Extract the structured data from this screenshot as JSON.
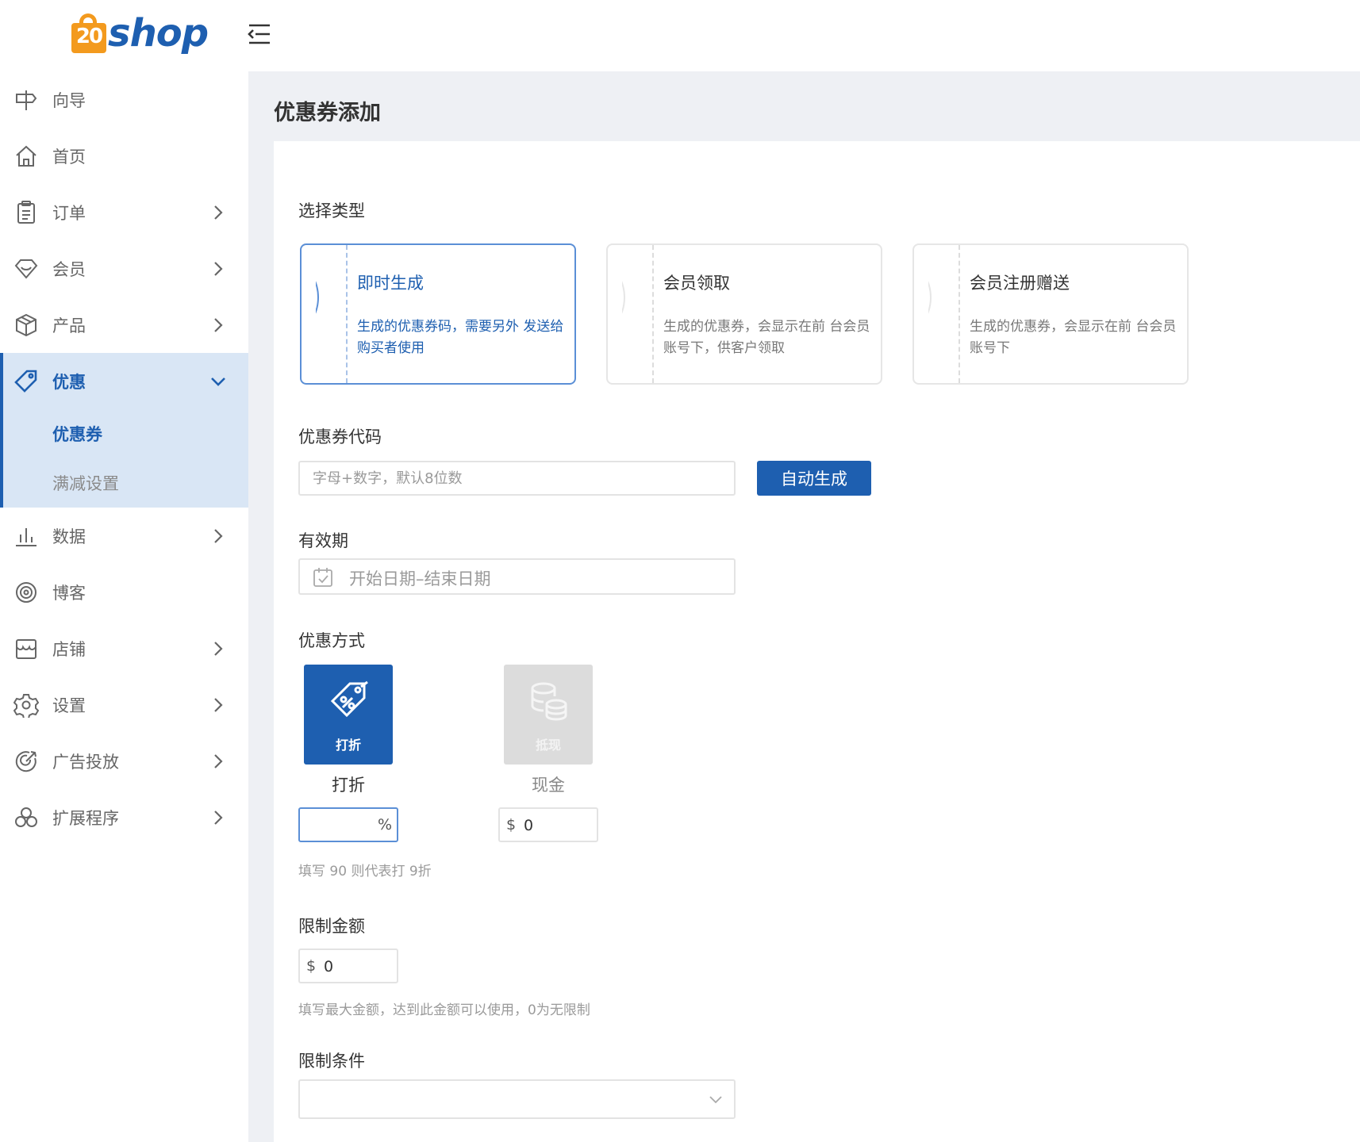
{
  "brand": {
    "logo_number": "20",
    "logo_text": "shop"
  },
  "sidebar": {
    "items": [
      {
        "label": "向导",
        "icon": "signpost-icon"
      },
      {
        "label": "首页",
        "icon": "home-icon"
      },
      {
        "label": "订单",
        "icon": "order-icon"
      },
      {
        "label": "会员",
        "icon": "member-icon"
      },
      {
        "label": "产品",
        "icon": "box-icon"
      },
      {
        "label": "优惠",
        "icon": "tag-icon"
      },
      {
        "label": "数据",
        "icon": "chart-icon"
      },
      {
        "label": "博客",
        "icon": "blog-icon"
      },
      {
        "label": "店铺",
        "icon": "store-icon"
      },
      {
        "label": "设置",
        "icon": "gear-icon"
      },
      {
        "label": "广告投放",
        "icon": "target-icon"
      },
      {
        "label": "扩展程序",
        "icon": "extension-icon"
      }
    ],
    "promo_sub": [
      {
        "label": "优惠券"
      },
      {
        "label": "满减设置"
      }
    ]
  },
  "page": {
    "title": "优惠券添加"
  },
  "form": {
    "type_label": "选择类型",
    "types": [
      {
        "title": "即时生成",
        "desc": "生成的优惠券码，需要另外 发送给购买者使用"
      },
      {
        "title": "会员领取",
        "desc": "生成的优惠券，会显示在前 台会员账号下，供客户领取"
      },
      {
        "title": "会员注册赠送",
        "desc": "生成的优惠券，会显示在前 台会员账号下"
      }
    ],
    "code_label": "优惠券代码",
    "code_placeholder": "字母+数字，默认8位数",
    "auto_generate": "自动生成",
    "validity_label": "有效期",
    "validity_placeholder": "开始日期–结束日期",
    "method_label": "优惠方式",
    "methods": [
      {
        "tile_text": "打折",
        "name": "打折"
      },
      {
        "tile_text": "抵现",
        "name": "现金"
      }
    ],
    "discount_suffix": "%",
    "discount_value": "",
    "cash_prefix": "$",
    "cash_value": "0",
    "discount_hint": "填写 90 则代表打 9折",
    "limit_amount_label": "限制金额",
    "limit_prefix": "$",
    "limit_value": "0",
    "limit_hint": "填写最大金额，达到此金额可以使用，0为无限制",
    "limit_condition_label": "限制条件",
    "limit_condition_value": ""
  },
  "colors": {
    "primary": "#1e5fb0",
    "accent": "#f39a1e",
    "active_bg": "#d9e6f5"
  }
}
